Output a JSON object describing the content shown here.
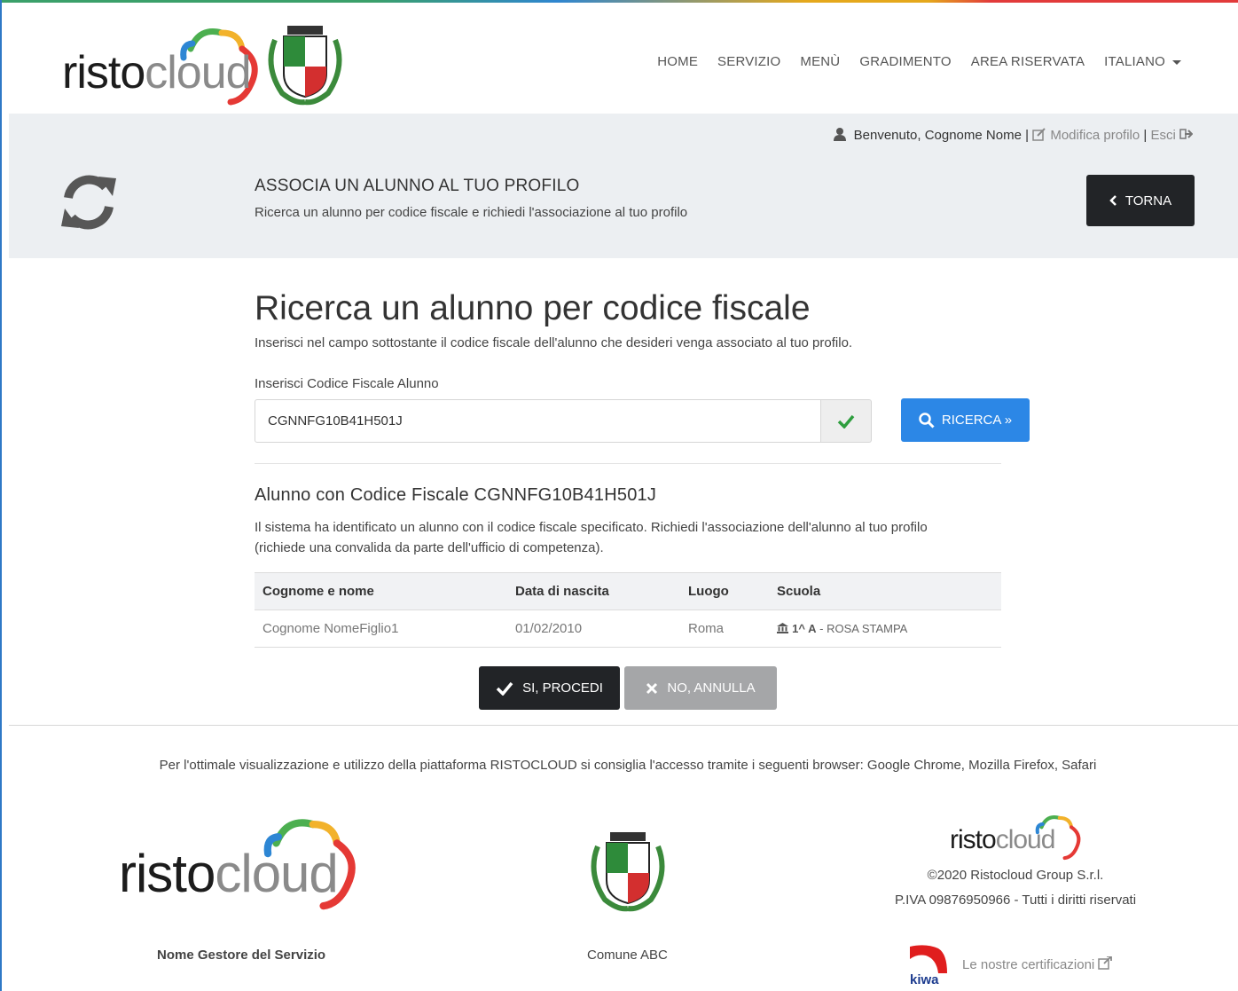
{
  "brand": {
    "logo_dark": "risto",
    "logo_light": "cloud"
  },
  "nav": {
    "items": [
      "HOME",
      "SERVIZIO",
      "MENÙ",
      "GRADIMENTO",
      "AREA RISERVATA"
    ],
    "language": "ITALIANO"
  },
  "user": {
    "welcome": "Benvenuto, Cognome Nome",
    "separator": "|",
    "edit_profile": "Modifica profilo",
    "logout": "Esci"
  },
  "banner": {
    "title": "ASSOCIA UN ALUNNO AL TUO PROFILO",
    "subtitle": "Ricerca un alunno per codice fiscale e richiedi l'associazione al tuo profilo",
    "back_label": "TORNA"
  },
  "search": {
    "heading": "Ricerca un alunno per codice fiscale",
    "lead": "Inserisci nel campo sottostante il codice fiscale dell'alunno che desideri venga associato al tuo profilo.",
    "field_label": "Inserisci Codice Fiscale Alunno",
    "value": "CGNNFG10B41H501J",
    "button_label": "RICERCA »"
  },
  "result": {
    "heading": "Alunno con Codice Fiscale CGNNFG10B41H501J",
    "text": "Il sistema ha identificato un alunno con il codice fiscale specificato. Richiedi l'associazione dell'alunno al tuo profilo (richiede una convalida da parte dell'ufficio di competenza).",
    "columns": [
      "Cognome e nome",
      "Data di nascita",
      "Luogo",
      "Scuola"
    ],
    "row": {
      "name": "Cognome NomeFiglio1",
      "birth_date": "01/02/2010",
      "place": "Roma",
      "school_class": "1^ A",
      "school_sep": " - ",
      "school_name": "ROSA STAMPA"
    },
    "confirm_label": "SI, PROCEDI",
    "cancel_label": "NO, ANNULLA"
  },
  "footer": {
    "browsers_note": "Per l'ottimale visualizzazione e utilizzo della piattaforma RISTOCLOUD si consiglia l'accesso tramite i seguenti browser: Google Chrome, Mozilla Firefox, Safari",
    "manager_caption": "Nome Gestore del Servizio",
    "municipality_caption": "Comune ABC",
    "copyright": "©2020 Ristocloud Group S.r.l.",
    "vat": "P.IVA 09876950966 - Tutti i diritti riservati",
    "certifications": "Le nostre certificazioni",
    "kiwa": "kiwa"
  },
  "colors": {
    "primary": "#2c87e6",
    "dark": "#222427",
    "banner_bg": "#eceff2",
    "success": "#2e9e3e"
  }
}
